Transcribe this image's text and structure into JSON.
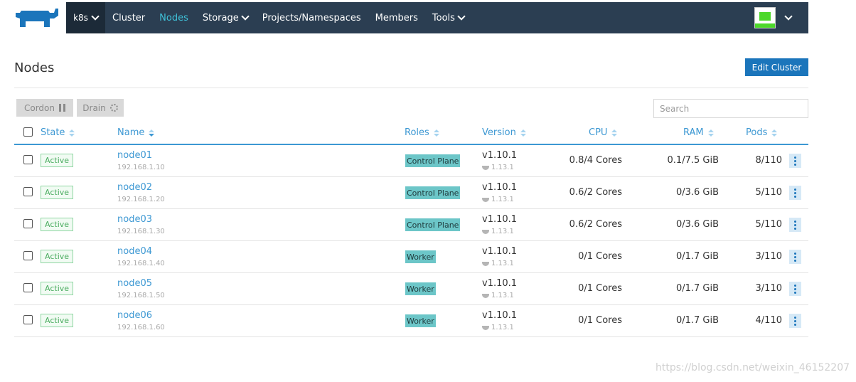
{
  "header": {
    "cluster": "k8s",
    "nav": [
      {
        "label": "Cluster",
        "active": false,
        "dropdown": false
      },
      {
        "label": "Nodes",
        "active": true,
        "dropdown": false
      },
      {
        "label": "Storage",
        "active": false,
        "dropdown": true
      },
      {
        "label": "Projects/Namespaces",
        "active": false,
        "dropdown": false
      },
      {
        "label": "Members",
        "active": false,
        "dropdown": false
      },
      {
        "label": "Tools",
        "active": false,
        "dropdown": true
      }
    ]
  },
  "page": {
    "title": "Nodes",
    "edit_label": "Edit Cluster"
  },
  "actions": {
    "cordon": "Cordon",
    "drain": "Drain",
    "search_placeholder": "Search"
  },
  "columns": {
    "state": "State",
    "name": "Name",
    "roles": "Roles",
    "version": "Version",
    "cpu": "CPU",
    "ram": "RAM",
    "pods": "Pods"
  },
  "rows": [
    {
      "state": "Active",
      "name": "node01",
      "ip": "192.168.1.10",
      "role": "Control Plane",
      "version": "v1.10.1",
      "docker": "1.13.1",
      "cpu": "0.8/4 Cores",
      "ram": "0.1/7.5 GiB",
      "pods": "8/110"
    },
    {
      "state": "Active",
      "name": "node02",
      "ip": "192.168.1.20",
      "role": "Control Plane",
      "version": "v1.10.1",
      "docker": "1.13.1",
      "cpu": "0.6/2 Cores",
      "ram": "0/3.6 GiB",
      "pods": "5/110"
    },
    {
      "state": "Active",
      "name": "node03",
      "ip": "192.168.1.30",
      "role": "Control Plane",
      "version": "v1.10.1",
      "docker": "1.13.1",
      "cpu": "0.6/2 Cores",
      "ram": "0/3.6 GiB",
      "pods": "5/110"
    },
    {
      "state": "Active",
      "name": "node04",
      "ip": "192.168.1.40",
      "role": "Worker",
      "version": "v1.10.1",
      "docker": "1.13.1",
      "cpu": "0/1 Cores",
      "ram": "0/1.7 GiB",
      "pods": "3/110"
    },
    {
      "state": "Active",
      "name": "node05",
      "ip": "192.168.1.50",
      "role": "Worker",
      "version": "v1.10.1",
      "docker": "1.13.1",
      "cpu": "0/1 Cores",
      "ram": "0/1.7 GiB",
      "pods": "3/110"
    },
    {
      "state": "Active",
      "name": "node06",
      "ip": "192.168.1.60",
      "role": "Worker",
      "version": "v1.10.1",
      "docker": "1.13.1",
      "cpu": "0/1 Cores",
      "ram": "0/1.7 GiB",
      "pods": "4/110"
    }
  ],
  "watermark": "https://blog.csdn.net/weixin_46152207",
  "colors": {
    "topbar": "#2b3e52",
    "accent": "#3d98d3",
    "primary_button": "#1b75bb",
    "active_nav": "#3fc1d8",
    "role_badge": "#6cc6c8",
    "state_active": "#4aac5f"
  },
  "icons": {
    "logo": "rancher-cow-logo",
    "cordon": "pause-icon",
    "drain": "spinner-icon",
    "docker": "docker-icon",
    "row_action": "vertical-dots-icon"
  }
}
